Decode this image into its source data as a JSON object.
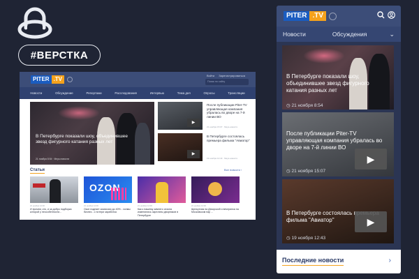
{
  "tag": "#ВЕРСТКА",
  "brand_logo_icon": "headset-logo-icon",
  "site": {
    "logo_part1": "PITER",
    "logo_part2": ".TV",
    "colors": {
      "header": "#3c4d78",
      "accent": "#f5a21c",
      "logo_blue": "#1a5cc0"
    }
  },
  "desktop": {
    "login": "Войти",
    "register": "Зарегистрироваться",
    "search_placeholder": "Поиск по сайту",
    "nav": [
      "Новости",
      "Обсуждение",
      "Репортажи",
      "Расследования",
      "Интервью",
      "Тема дня",
      "Опросы",
      "Трансляции"
    ],
    "hero": {
      "title": "В Петербурге показали шоу, объединившее звезд фигурного катания разных лет",
      "meta": "21 ноября 8:54 · Мнук-новости"
    },
    "side": [
      {
        "title": "После публикации Piter-TV управляющая компания убралась во дворе на 7-й линии ВО",
        "meta": "21 ноября 15:07 · Мнук-новости"
      },
      {
        "title": "В Петербурге состоялась премьера фильма \"Авиатор\"",
        "meta": "19 ноября 12:43 · Мнук-новости"
      }
    ],
    "section_title": "Статьи",
    "section_all": "Все новости  ›",
    "cards": [
      {
        "meta": "21 ноября 12:00",
        "text": "И прочем, кто, и за добро подборка которой у неособенности..."
      },
      {
        "meta": "21 ноября 12:00",
        "text": "Озон подняет комиссии до 40% - холмы бизнес - с потери заработка"
      },
      {
        "meta": "21 ноября 12:00",
        "text": "Как к нашему зимнего сезона изменились зарплаты дворников в Петербурге"
      },
      {
        "meta": "21 ноября 12:00",
        "text": "Щелкунчик на Декорской и вечеринка на Московском пар ..."
      }
    ]
  },
  "mobile": {
    "tabs": [
      "Новости",
      "Обсуждения"
    ],
    "cards": [
      {
        "title": "В Петербурге показали шоу, объединившее звезд фигурного катания разных лет",
        "meta": "21 ноября 8:54"
      },
      {
        "title": "После публикации Piter-TV управляющая компания убралась во дворе на 7-й линии ВО",
        "meta": "21 ноября 15:07"
      },
      {
        "title": "В Петербурге состоялась премьера фильма \"Авиатор\"",
        "meta": "19 ноября 12:43"
      }
    ],
    "footer_title": "Последние новости",
    "footer_arrow": "›",
    "icons": [
      "search-icon",
      "user-icon",
      "chevron-down-icon",
      "play-icon"
    ]
  }
}
